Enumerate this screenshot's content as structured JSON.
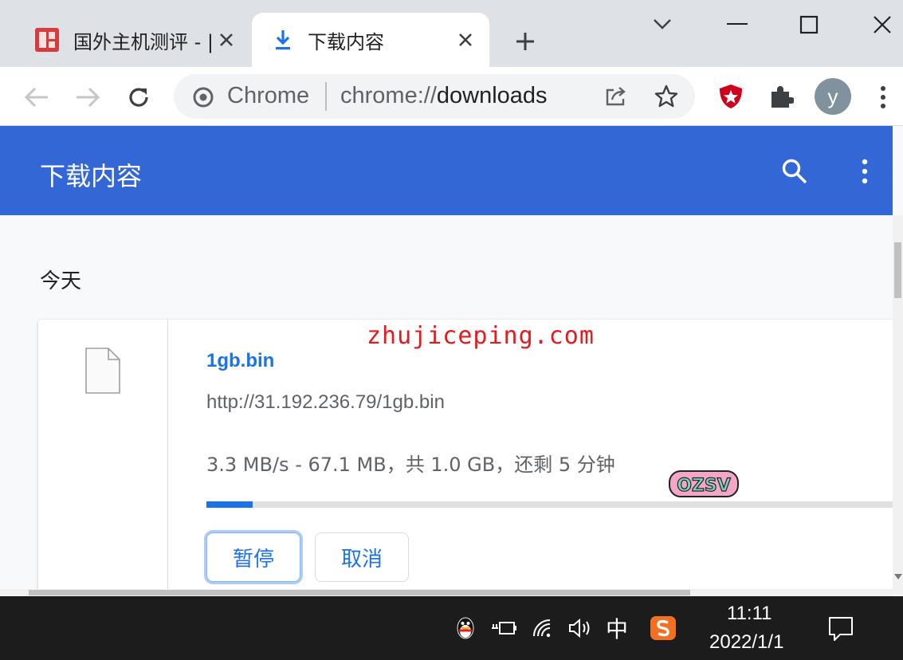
{
  "tabs": [
    {
      "title": "国外主机测评 - |",
      "active": false
    },
    {
      "title": "下载内容",
      "active": true
    }
  ],
  "omnibox": {
    "origin": "Chrome",
    "url_prefix": "chrome://",
    "url_path": "downloads"
  },
  "profile": {
    "initial": "y"
  },
  "page": {
    "title": "下载内容"
  },
  "section": {
    "label": "今天"
  },
  "download": {
    "file_name": "1gb.bin",
    "url": "http://31.192.236.79/1gb.bin",
    "status": "3.3 MB/s - 67.1 MB，共 1.0 GB，还剩 5 分钟",
    "progress_fraction": 0.067,
    "pause_label": "暂停",
    "cancel_label": "取消"
  },
  "watermark": {
    "text": "zhujiceping.com",
    "badge": "OZSV"
  },
  "taskbar": {
    "time": "11:11",
    "date": "2022/1/1",
    "ime": "中"
  },
  "colors": {
    "header": "#3367d6",
    "accent": "#1a73e8",
    "watermark": "#e8191e"
  }
}
